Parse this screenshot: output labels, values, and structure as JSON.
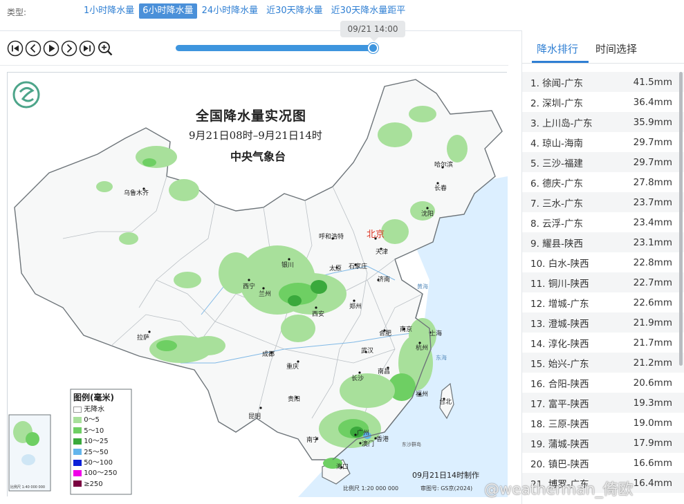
{
  "typebar": {
    "label": "类型:",
    "tabs": [
      "1小时降水量",
      "6小时降水量",
      "24小时降水量",
      "近30天降水量",
      "近30天降水量距平"
    ],
    "active_tab": "6小时降水量"
  },
  "player": {
    "time": "09/21 14:00",
    "progress": 1.0,
    "buttons": [
      "first-icon",
      "prev-icon",
      "play-icon",
      "next-icon",
      "last-icon",
      "zoom-in-icon"
    ]
  },
  "map": {
    "title": "全国降水量实况图",
    "subtitle": "9月21日08时–9月21日14时",
    "agency": "中央气象台",
    "legend_title": "图例(毫米)",
    "legend": [
      {
        "label": "无降水",
        "color": "#ffffff"
      },
      {
        "label": "0～5",
        "color": "#a8e09b"
      },
      {
        "label": "5～10",
        "color": "#6ecf63"
      },
      {
        "label": "10～25",
        "color": "#3aa93c"
      },
      {
        "label": "25～50",
        "color": "#63b5ec"
      },
      {
        "label": "50～100",
        "color": "#0b20d8"
      },
      {
        "label": "100～250",
        "color": "#f000e8"
      },
      {
        "label": "≥250",
        "color": "#7a0040"
      }
    ],
    "cities": [
      "乌鲁木齐",
      "哈尔滨",
      "长春",
      "沈阳",
      "呼和浩特",
      "北京",
      "天津",
      "银川",
      "太原",
      "石家庄",
      "济南",
      "西宁",
      "兰州",
      "西安",
      "郑州",
      "合肥",
      "南京",
      "上海",
      "杭州",
      "拉萨",
      "成都",
      "武汉",
      "重庆",
      "长沙",
      "南昌",
      "福州",
      "台北",
      "贵阳",
      "昆明",
      "南宁",
      "广州",
      "香港",
      "澳门",
      "海口",
      "东沙群岛",
      "黄海",
      "东海"
    ],
    "footer_time": "09月21日14时制作",
    "scale": "比例尺 1:20 000 000",
    "review": "审图号: GS京(2024)",
    "inset_scale": "比例尺 1:40 000 000"
  },
  "ranking": {
    "tabs": [
      "降水排行",
      "时间选择"
    ],
    "active_tab": "降水排行",
    "rows": [
      {
        "name": "1. 徐闻-广东",
        "value": "41.5mm"
      },
      {
        "name": "2. 深圳-广东",
        "value": "36.4mm"
      },
      {
        "name": "3. 上川岛-广东",
        "value": "35.9mm"
      },
      {
        "name": "4. 琼山-海南",
        "value": "29.7mm"
      },
      {
        "name": "5. 三沙-福建",
        "value": "29.7mm"
      },
      {
        "name": "6. 德庆-广东",
        "value": "27.8mm"
      },
      {
        "name": "7. 三水-广东",
        "value": "23.7mm"
      },
      {
        "name": "8. 云浮-广东",
        "value": "23.4mm"
      },
      {
        "name": "9. 耀县-陕西",
        "value": "23.1mm"
      },
      {
        "name": "10. 白水-陕西",
        "value": "22.8mm"
      },
      {
        "name": "11. 铜川-陕西",
        "value": "22.7mm"
      },
      {
        "name": "12. 增城-广东",
        "value": "22.6mm"
      },
      {
        "name": "13. 澄城-陕西",
        "value": "21.9mm"
      },
      {
        "name": "14. 淳化-陕西",
        "value": "21.7mm"
      },
      {
        "name": "15. 始兴-广东",
        "value": "21.2mm"
      },
      {
        "name": "16. 合阳-陕西",
        "value": "20.6mm"
      },
      {
        "name": "17. 富平-陕西",
        "value": "19.3mm"
      },
      {
        "name": "18. 三原-陕西",
        "value": "19.0mm"
      },
      {
        "name": "19. 蒲城-陕西",
        "value": "17.9mm"
      },
      {
        "name": "20. 镇巴-陕西",
        "value": "16.6mm"
      },
      {
        "name": "21. 博罗-广东",
        "value": "16.4mm"
      }
    ]
  },
  "watermark": "@weatherman_倚欧"
}
